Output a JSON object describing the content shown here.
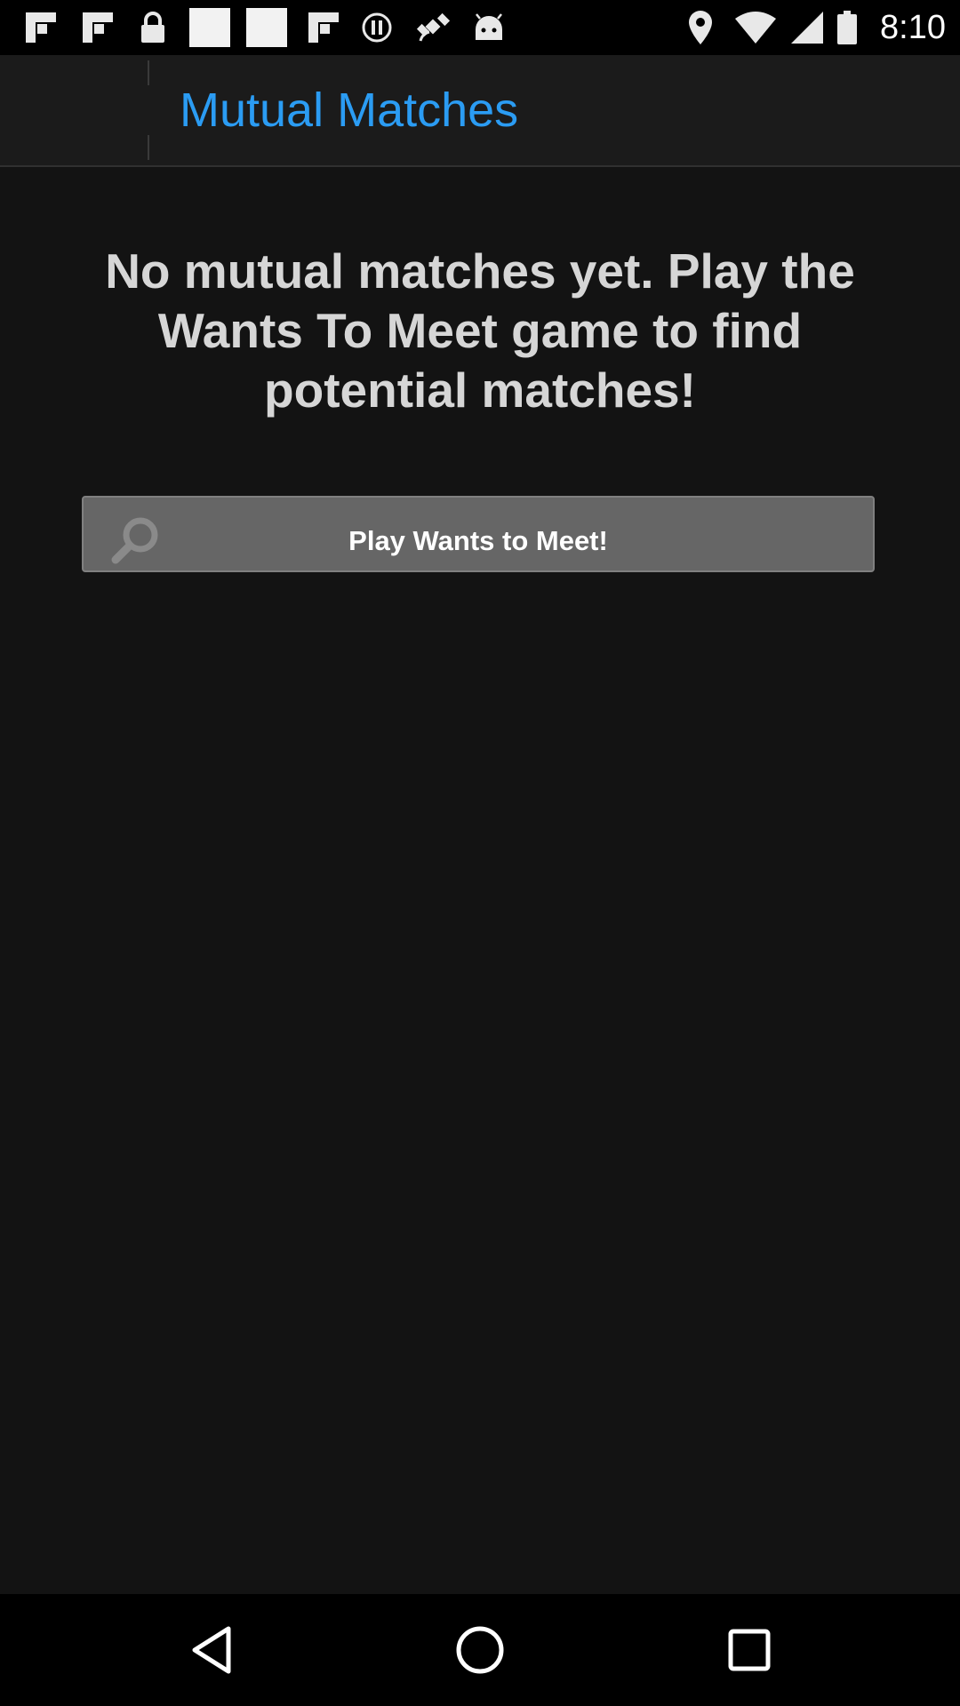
{
  "status_bar": {
    "time": "8:10",
    "left_icons": [
      "flipboard-icon",
      "flipboard-icon",
      "lock-icon",
      "blank-notification-icon",
      "blank-notification-icon",
      "flipboard-icon",
      "info-icon",
      "fake-gps-icon",
      "android-icon"
    ],
    "right_icons": [
      "location-icon",
      "wifi-icon",
      "signal-icon",
      "battery-icon"
    ]
  },
  "action_bar": {
    "title": "Mutual Matches",
    "title_color": "#2b9cf3"
  },
  "main": {
    "empty_message": "No mutual matches yet. Play the Wants To Meet game to find potential matches!",
    "play_button": {
      "label": "Play Wants to Meet!",
      "icon": "search-icon"
    }
  },
  "nav_bar": {
    "buttons": [
      "back-icon",
      "home-icon",
      "recents-icon"
    ]
  }
}
